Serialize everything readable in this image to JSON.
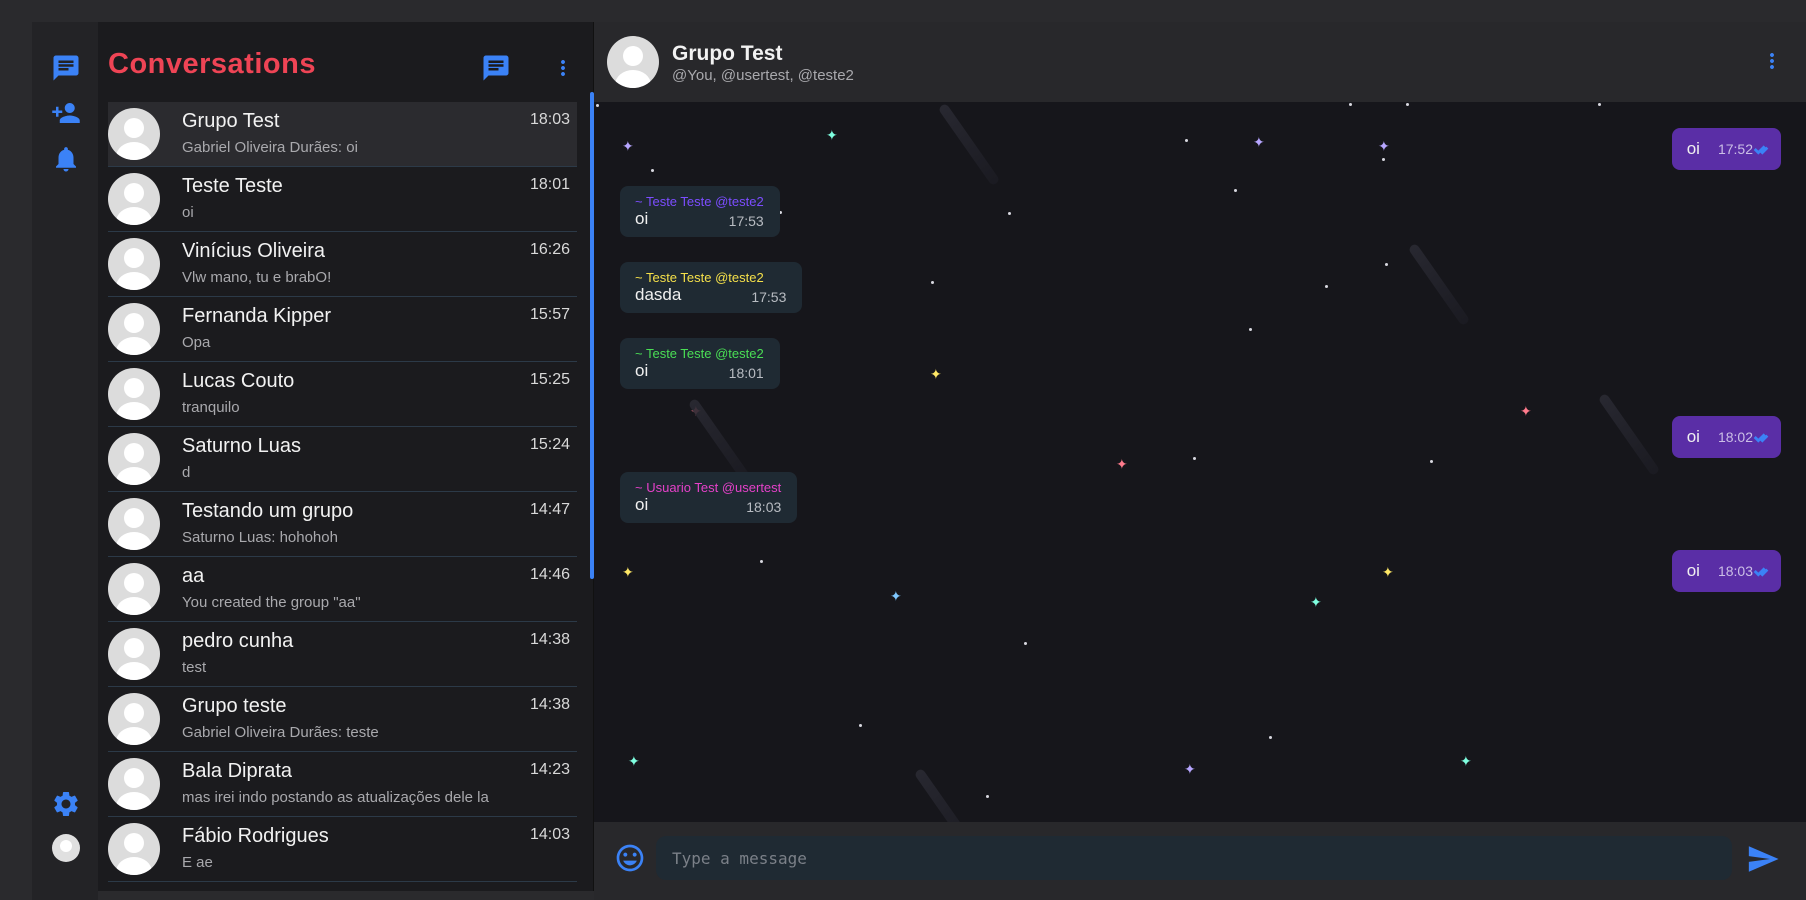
{
  "rail": {
    "icons": [
      "chat-icon",
      "add-person-icon",
      "bell-icon",
      "gear-icon"
    ]
  },
  "conversations": {
    "title": "Conversations",
    "items": [
      {
        "name": "Grupo Test",
        "preview": "Gabriel Oliveira Durães: oi",
        "time": "18:03"
      },
      {
        "name": "Teste Teste",
        "preview": "oi",
        "time": "18:01"
      },
      {
        "name": "Vinícius Oliveira",
        "preview": "Vlw mano, tu e brabO!",
        "time": "16:26"
      },
      {
        "name": "Fernanda Kipper",
        "preview": "Opa",
        "time": "15:57"
      },
      {
        "name": "Lucas Couto",
        "preview": "tranquilo",
        "time": "15:25"
      },
      {
        "name": "Saturno Luas",
        "preview": "d",
        "time": "15:24"
      },
      {
        "name": "Testando um grupo",
        "preview": "Saturno Luas: hohohoh",
        "time": "14:47"
      },
      {
        "name": "aa",
        "preview": "You created the group \"aa\"",
        "time": "14:46"
      },
      {
        "name": "pedro cunha",
        "preview": "test",
        "time": "14:38"
      },
      {
        "name": "Grupo teste",
        "preview": "Gabriel Oliveira Durães: teste",
        "time": "14:38"
      },
      {
        "name": "Bala Diprata",
        "preview": "mas irei indo postando as atualizações dele la",
        "time": "14:23"
      },
      {
        "name": "Fábio Rodrigues",
        "preview": "E ae",
        "time": "14:03"
      }
    ]
  },
  "chat": {
    "title": "Grupo Test",
    "members": "@You, @usertest, @teste2",
    "messages": [
      {
        "dir": "out",
        "text": "oi",
        "time": "17:52"
      },
      {
        "dir": "in",
        "sender": "~ Teste Teste @teste2",
        "sender_color": "#7c4dff",
        "text": "oi",
        "time": "17:53"
      },
      {
        "dir": "in",
        "sender": "~ Teste Teste @teste2",
        "sender_color": "#f5e04a",
        "text": "dasda",
        "time": "17:53"
      },
      {
        "dir": "in",
        "sender": "~ Teste Teste @teste2",
        "sender_color": "#4ade55",
        "text": "oi",
        "time": "18:01"
      },
      {
        "dir": "out",
        "text": "oi",
        "time": "18:02"
      },
      {
        "dir": "in",
        "sender": "~ Usuario Test @usertest",
        "sender_color": "#e541c9",
        "text": "oi",
        "time": "18:03"
      },
      {
        "dir": "out",
        "text": "oi",
        "time": "18:03"
      }
    ]
  },
  "composer": {
    "placeholder": "Type a message"
  },
  "colors": {
    "accent": "#3b82f6",
    "title_red": "#ef4455",
    "outgoing_bubble": "#5a2ea6",
    "incoming_bubble": "#1f2a33"
  }
}
